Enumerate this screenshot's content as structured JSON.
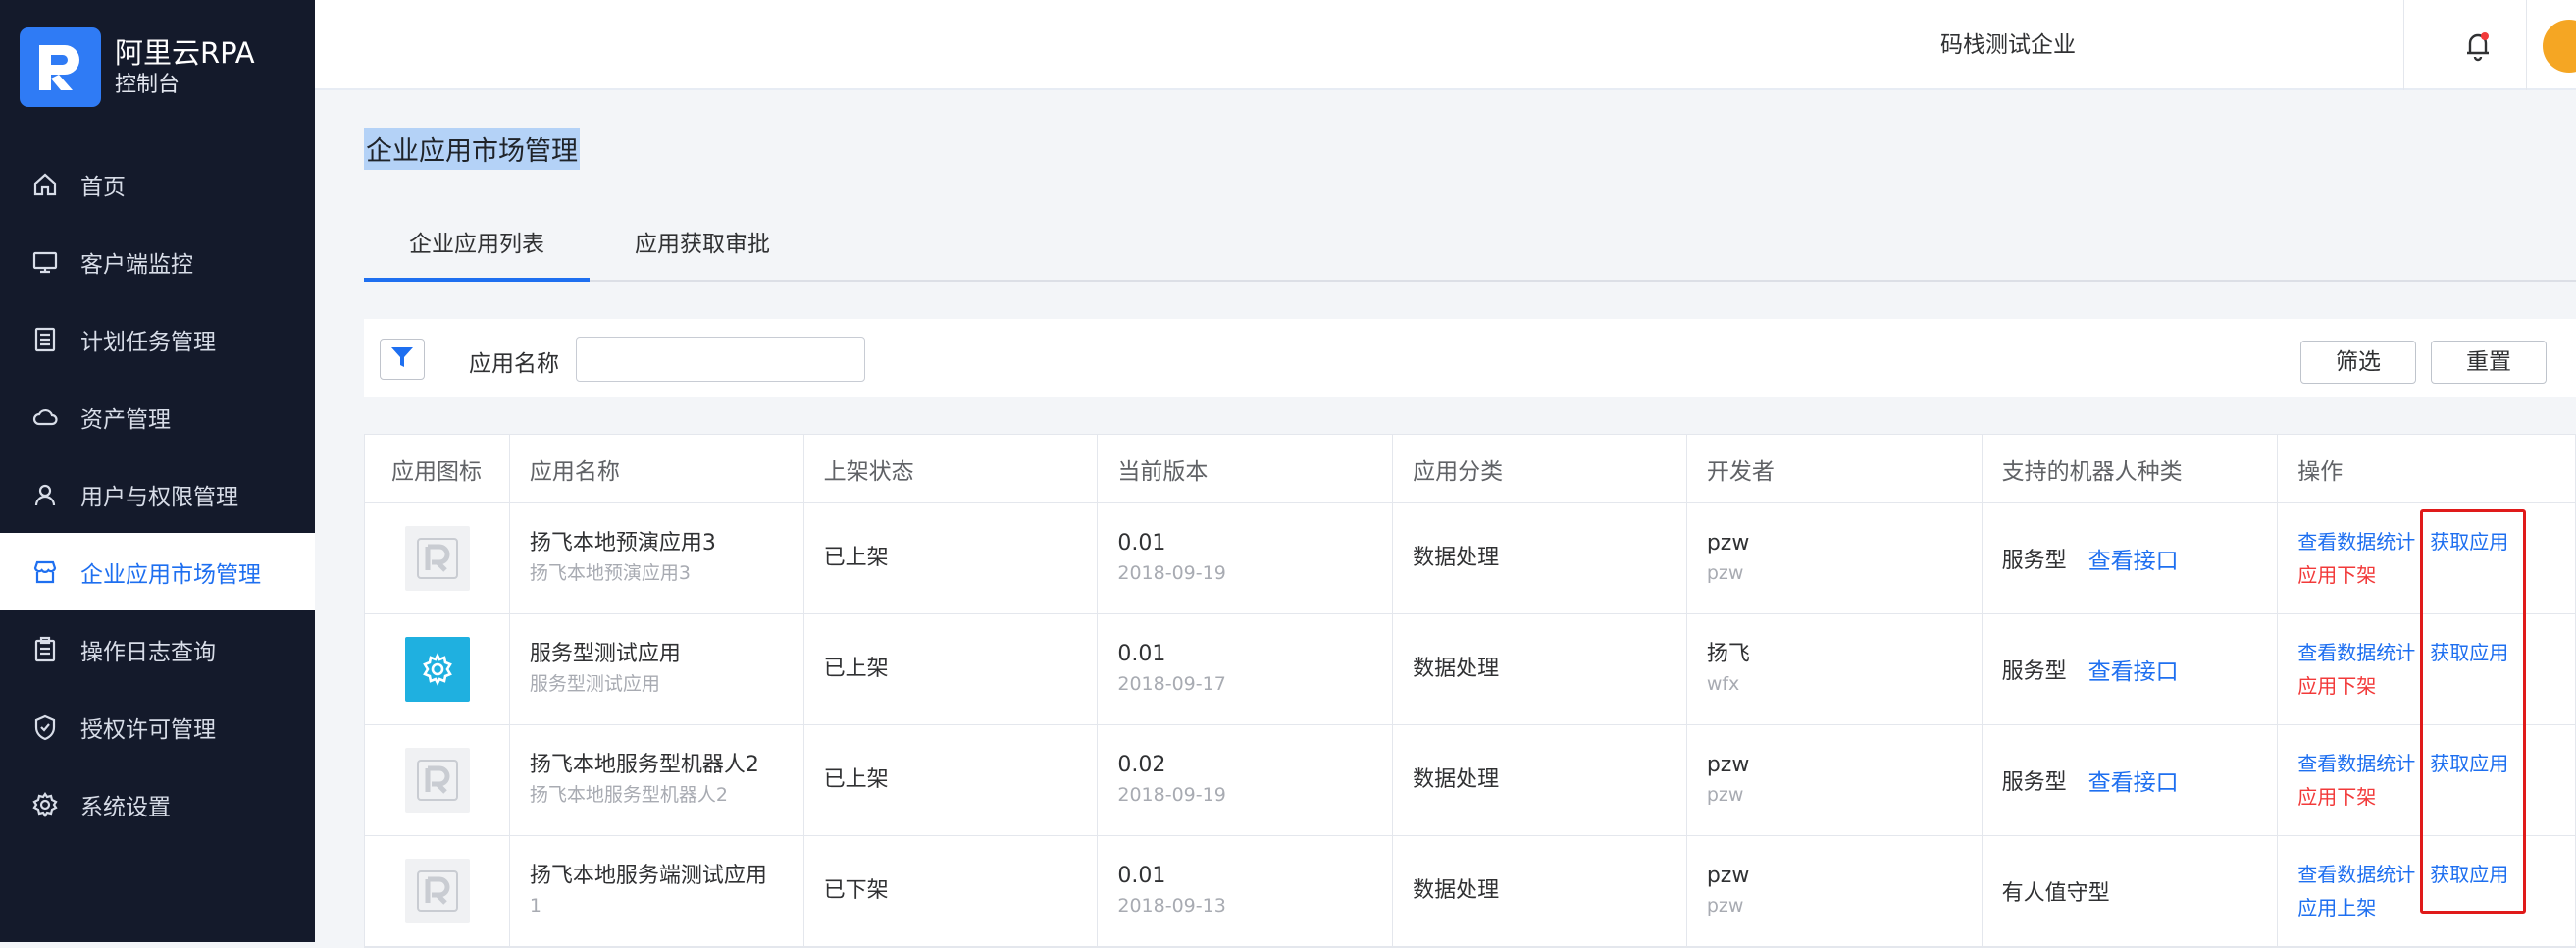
{
  "brand": {
    "title": "阿里云RPA",
    "subtitle": "控制台"
  },
  "nav": [
    {
      "label": "首页",
      "icon": "home-icon"
    },
    {
      "label": "客户端监控",
      "icon": "monitor-icon"
    },
    {
      "label": "计划任务管理",
      "icon": "task-list-icon"
    },
    {
      "label": "资产管理",
      "icon": "cloud-icon"
    },
    {
      "label": "用户与权限管理",
      "icon": "user-icon"
    },
    {
      "label": "企业应用市场管理",
      "icon": "store-icon",
      "active": true
    },
    {
      "label": "操作日志查询",
      "icon": "clipboard-icon"
    },
    {
      "label": "授权许可管理",
      "icon": "shield-icon"
    },
    {
      "label": "系统设置",
      "icon": "gear-icon"
    }
  ],
  "topbar": {
    "company": "码栈测试企业"
  },
  "page": {
    "title": "企业应用市场管理"
  },
  "tabs": [
    "企业应用列表",
    "应用获取审批"
  ],
  "filter": {
    "label": "应用名称",
    "placeholder": "",
    "screen_label": "筛选",
    "reset_label": "重置"
  },
  "table": {
    "headers": [
      "应用图标",
      "应用名称",
      "上架状态",
      "当前版本",
      "应用分类",
      "开发者",
      "支持的机器人种类",
      "操作"
    ],
    "rows": [
      {
        "name": "扬飞本地预演应用3",
        "sub": "扬飞本地预演应用3",
        "status": "已上架",
        "version": "0.01",
        "date": "2018-09-19",
        "category": "数据处理",
        "dev": "pzw",
        "dev_sub": "pzw",
        "robot": "服务型",
        "robot_link": "查看接口",
        "op1": "查看数据统计",
        "op2": "应用下架",
        "op_get": "获取应用",
        "icon": "default"
      },
      {
        "name": "服务型测试应用",
        "sub": "服务型测试应用",
        "status": "已上架",
        "version": "0.01",
        "date": "2018-09-17",
        "category": "数据处理",
        "dev": "扬飞",
        "dev_sub": "wfx",
        "robot": "服务型",
        "robot_link": "查看接口",
        "op1": "查看数据统计",
        "op2": "应用下架",
        "op_get": "获取应用",
        "icon": "gear"
      },
      {
        "name": "扬飞本地服务型机器人2",
        "sub": "扬飞本地服务型机器人2",
        "status": "已上架",
        "version": "0.02",
        "date": "2018-09-19",
        "category": "数据处理",
        "dev": "pzw",
        "dev_sub": "pzw",
        "robot": "服务型",
        "robot_link": "查看接口",
        "op1": "查看数据统计",
        "op2": "应用下架",
        "op_get": "获取应用",
        "icon": "default"
      },
      {
        "name": "扬飞本地服务端测试应用",
        "sub": "1",
        "status": "已下架",
        "version": "0.01",
        "date": "2018-09-13",
        "category": "数据处理",
        "dev": "pzw",
        "dev_sub": "pzw",
        "robot": "有人值守型",
        "robot_link": "",
        "op1": "查看数据统计",
        "op2": "应用上架",
        "op_get": "获取应用",
        "icon": "default"
      }
    ]
  },
  "colors": {
    "sidebar": "#141a2b",
    "accent": "#1e6ff0",
    "danger": "#f23a3a",
    "highlight_box": "#e01a1a"
  }
}
